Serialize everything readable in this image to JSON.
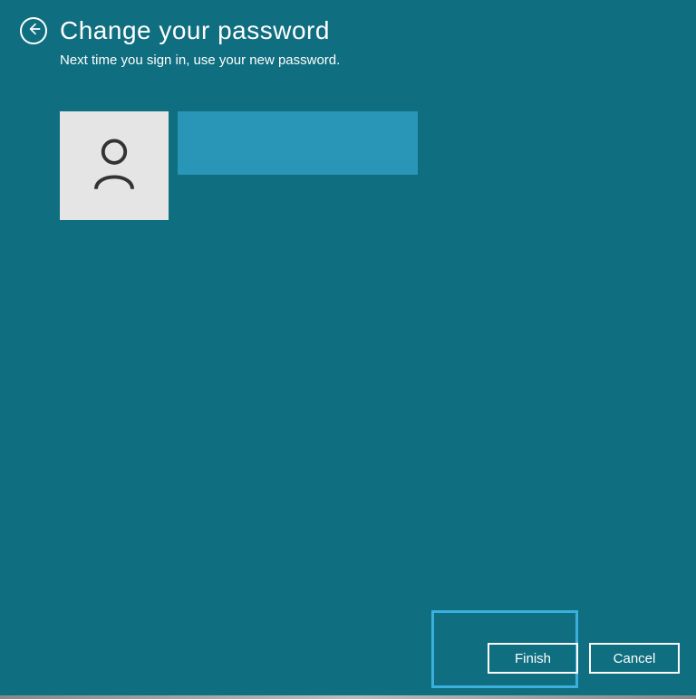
{
  "header": {
    "title": "Change your password",
    "subtitle": "Next time you sign in, use your new password."
  },
  "buttons": {
    "finish": "Finish",
    "cancel": "Cancel"
  }
}
